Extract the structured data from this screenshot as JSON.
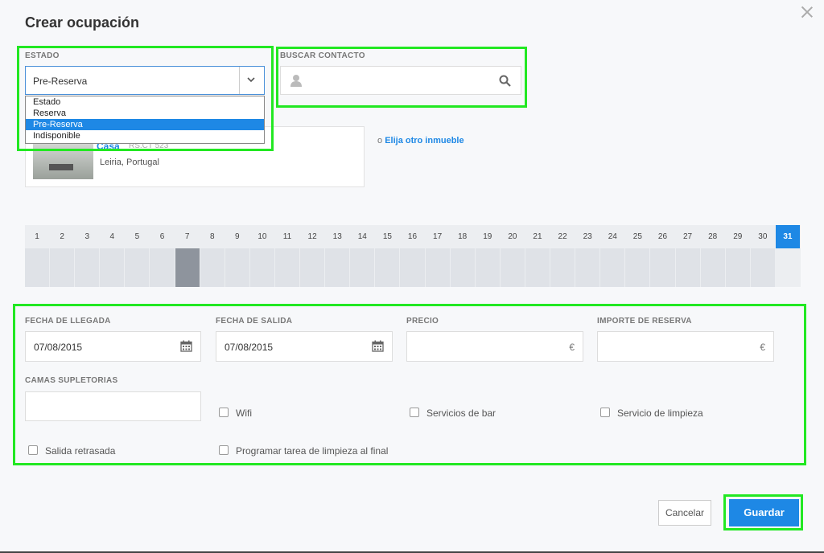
{
  "dialog": {
    "title": "Crear ocupación"
  },
  "estado": {
    "label": "ESTADO",
    "selected": "Pre-Reserva",
    "options": [
      "Estado",
      "Reserva",
      "Pre-Reserva",
      "Indisponible"
    ]
  },
  "contacto": {
    "label": "BUSCAR CONTACTO",
    "value": ""
  },
  "property": {
    "name": "Casa",
    "ref": "RS.CT 523",
    "location": "Leiria, Portugal",
    "other_prefix": "o",
    "other_link": "Elija otro inmueble"
  },
  "calendar": {
    "days": [
      "1",
      "2",
      "3",
      "4",
      "5",
      "6",
      "7",
      "8",
      "9",
      "10",
      "11",
      "12",
      "13",
      "14",
      "15",
      "16",
      "17",
      "18",
      "19",
      "20",
      "21",
      "22",
      "23",
      "24",
      "25",
      "26",
      "27",
      "28",
      "29",
      "30",
      "31"
    ],
    "blocked_day": "7",
    "today": "31"
  },
  "form": {
    "llegada": {
      "label": "FECHA DE LLEGADA",
      "value": "07/08/2015"
    },
    "salida": {
      "label": "FECHA DE SALIDA",
      "value": "07/08/2015"
    },
    "precio": {
      "label": "PRECIO",
      "value": "",
      "currency": "€"
    },
    "importe": {
      "label": "IMPORTE DE RESERVA",
      "value": "",
      "currency": "€"
    },
    "camas": {
      "label": "CAMAS SUPLETORIAS",
      "value": ""
    },
    "checkboxes": {
      "wifi": "Wifi",
      "bar": "Servicios de bar",
      "limpieza": "Servicio de limpieza",
      "salida": "Salida retrasada",
      "tarea": "Programar tarea de limpieza al final"
    }
  },
  "actions": {
    "cancel": "Cancelar",
    "save": "Guardar"
  },
  "colors": {
    "accent": "#1e88e5",
    "highlight": "#22e822"
  }
}
